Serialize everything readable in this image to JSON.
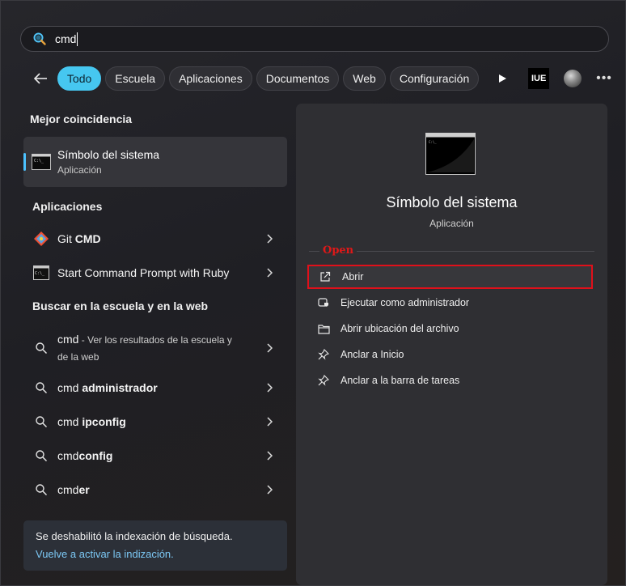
{
  "search": {
    "value": "cmd"
  },
  "filters": {
    "chips": [
      "Todo",
      "Escuela",
      "Aplicaciones",
      "Documentos",
      "Web",
      "Configuración"
    ],
    "active": "Todo",
    "org_badge": "IUE"
  },
  "left": {
    "best_match_heading": "Mejor coincidencia",
    "best_match": {
      "title": "Símbolo del sistema",
      "subtitle": "Aplicación"
    },
    "apps_heading": "Aplicaciones",
    "apps": [
      {
        "label_plain": "Git ",
        "label_bold": "CMD"
      },
      {
        "label_plain": "Start Command Prompt with Ruby",
        "label_bold": ""
      }
    ],
    "web_heading": "Buscar en la escuela y en la web",
    "web_first": {
      "query": "cmd",
      "desc_line1": " - Ver los resultados de la escuela y",
      "desc_line2": "de la web"
    },
    "web_results": [
      {
        "plain": "cmd ",
        "bold": "administrador"
      },
      {
        "plain": "cmd ",
        "bold": "ipconfig"
      },
      {
        "plain": "cmd",
        "bold": "config"
      },
      {
        "plain": "cmd",
        "bold": "er"
      }
    ],
    "notice": {
      "text": "Se deshabilitó la indexación de búsqueda.",
      "link": "Vuelve a activar la indización."
    }
  },
  "right": {
    "title": "Símbolo del sistema",
    "subtitle": "Aplicación",
    "annotation": "Open",
    "actions": [
      {
        "label": "Abrir",
        "icon": "open-external-icon"
      },
      {
        "label": "Ejecutar como administrador",
        "icon": "shield-admin-icon"
      },
      {
        "label": "Abrir ubicación del archivo",
        "icon": "folder-icon"
      },
      {
        "label": "Anclar a Inicio",
        "icon": "pin-icon"
      },
      {
        "label": "Anclar a la barra de tareas",
        "icon": "pin-icon"
      }
    ]
  },
  "colors": {
    "accent": "#46c7f0",
    "highlight_box": "#e0101a",
    "link": "#7cc8f5"
  }
}
